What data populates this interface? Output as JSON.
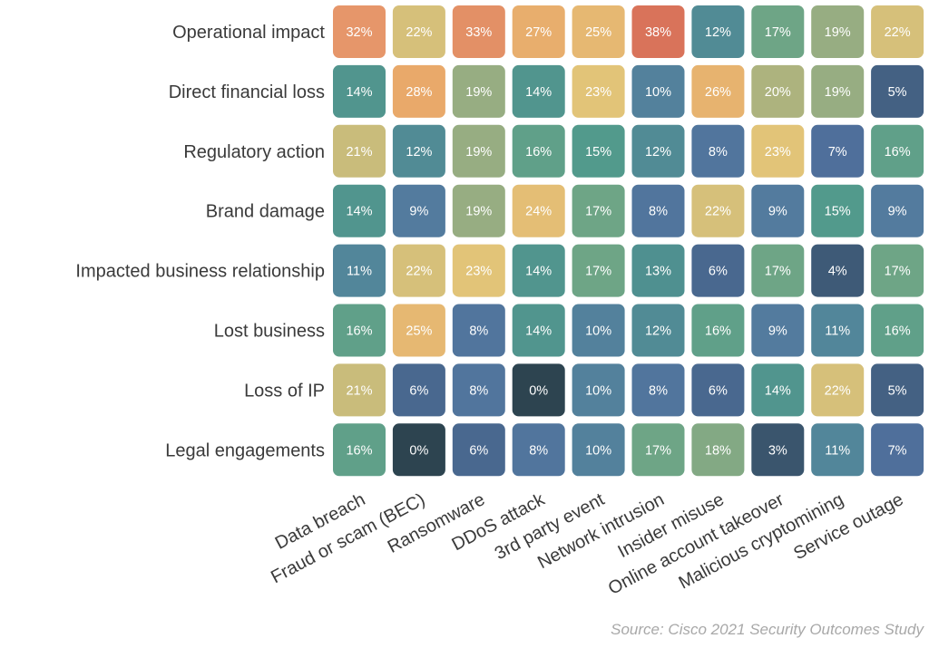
{
  "chart_data": {
    "type": "heatmap",
    "title": "",
    "xlabel": "",
    "ylabel": "",
    "value_format": "percent",
    "rows": [
      "Operational impact",
      "Direct financial loss",
      "Regulatory action",
      "Brand damage",
      "Impacted business relationship",
      "Lost business",
      "Loss of IP",
      "Legal engagements"
    ],
    "columns": [
      "Data breach",
      "Fraud or scam (BEC)",
      "Ransomware",
      "DDoS attack",
      "3rd party event",
      "Network intrusion",
      "Insider misuse",
      "Online account takeover",
      "Malicious cryptomining",
      "Service outage"
    ],
    "values": [
      [
        32,
        22,
        33,
        27,
        25,
        38,
        12,
        17,
        19,
        22
      ],
      [
        14,
        28,
        19,
        14,
        23,
        10,
        26,
        20,
        19,
        5
      ],
      [
        21,
        12,
        19,
        16,
        15,
        12,
        8,
        23,
        7,
        16
      ],
      [
        14,
        9,
        19,
        24,
        17,
        8,
        22,
        9,
        15,
        9
      ],
      [
        11,
        22,
        23,
        14,
        17,
        13,
        6,
        17,
        4,
        17
      ],
      [
        16,
        25,
        8,
        14,
        10,
        12,
        16,
        9,
        11,
        16
      ],
      [
        21,
        6,
        8,
        0,
        10,
        8,
        6,
        14,
        22,
        5
      ],
      [
        16,
        0,
        6,
        8,
        10,
        17,
        18,
        3,
        11,
        7
      ]
    ],
    "color_scale": [
      {
        "value": 0,
        "color": "#2d4450"
      },
      {
        "value": 4,
        "color": "#3e5a77"
      },
      {
        "value": 7,
        "color": "#4f6f9b"
      },
      {
        "value": 9,
        "color": "#537b9e"
      },
      {
        "value": 11,
        "color": "#52869a"
      },
      {
        "value": 13,
        "color": "#4f9090"
      },
      {
        "value": 15,
        "color": "#529a8c"
      },
      {
        "value": 17,
        "color": "#6ea586"
      },
      {
        "value": 19,
        "color": "#97ad82"
      },
      {
        "value": 20,
        "color": "#adb37e"
      },
      {
        "value": 21,
        "color": "#c9bc7b"
      },
      {
        "value": 23,
        "color": "#e2c478"
      },
      {
        "value": 25,
        "color": "#e6b872"
      },
      {
        "value": 28,
        "color": "#e9a96a"
      },
      {
        "value": 32,
        "color": "#e6966a"
      },
      {
        "value": 33,
        "color": "#e39066"
      },
      {
        "value": 38,
        "color": "#d9735a"
      }
    ],
    "source": "Source: Cisco 2021 Security Outcomes Study"
  }
}
